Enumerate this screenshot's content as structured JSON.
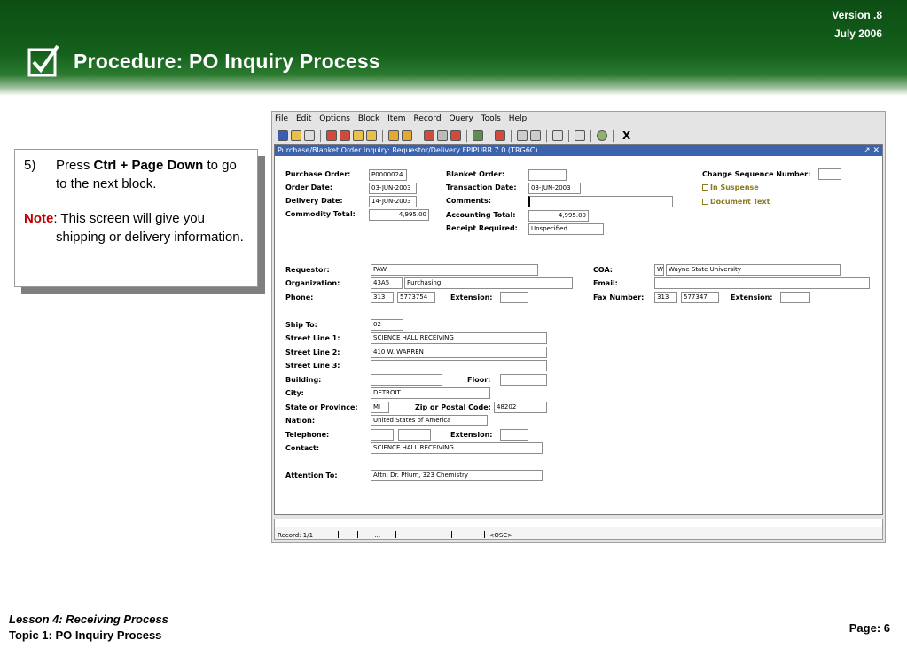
{
  "header": {
    "version": "Version .8",
    "date": "July  2006",
    "title": "Procedure: PO Inquiry Process"
  },
  "callout": {
    "step_num": "5)",
    "step_pre": "Press ",
    "step_bold": "Ctrl + Page Down",
    "step_post": " to go to the next block.",
    "note_label": "Note",
    "note_text": ":  This screen will give you shipping or delivery information."
  },
  "app": {
    "menu": [
      "File",
      "Edit",
      "Options",
      "Block",
      "Item",
      "Record",
      "Query",
      "Tools",
      "Help"
    ],
    "toolbar_exit": "X",
    "window_title": "Purchase/Blanket Order Inquiry: Requestor/Delivery  FPIPURR  7.0  (TRG6C)",
    "window_controls": "↗ ✕",
    "header_block": {
      "purchase_order_label": "Purchase Order:",
      "purchase_order": "P0000024",
      "order_date_label": "Order Date:",
      "order_date": "03-JUN-2003",
      "delivery_date_label": "Delivery Date:",
      "delivery_date": "14-JUN-2003",
      "commodity_total_label": "Commodity Total:",
      "commodity_total": "4,995.00",
      "blanket_order_label": "Blanket Order:",
      "blanket_order": "",
      "transaction_date_label": "Transaction Date:",
      "transaction_date": "03-JUN-2003",
      "comments_label": "Comments:",
      "comments": "",
      "accounting_total_label": "Accounting Total:",
      "accounting_total": "4,995.00",
      "receipt_required_label": "Receipt Required:",
      "receipt_required": "Unspecified",
      "change_seq_label": "Change Sequence Number:",
      "change_seq": "",
      "in_suspense_label": "In Suspense",
      "document_text_label": "Document Text"
    },
    "requestor_block": {
      "requestor_label": "Requestor:",
      "requestor": "PAW",
      "organization_label": "Organization:",
      "org_code": "43A5",
      "org_name": "Purchasing",
      "phone_label": "Phone:",
      "phone_area": "313",
      "phone_number": "5773754",
      "extension_label": "Extension:",
      "extension": "",
      "coa_label": "COA:",
      "coa_code": "W",
      "coa_name": "Wayne State University",
      "email_label": "Email:",
      "email": "",
      "fax_label": "Fax Number:",
      "fax_area": "313",
      "fax_number": "577347",
      "fax_extension_label": "Extension:",
      "fax_extension": ""
    },
    "ship_block": {
      "ship_to_label": "Ship To:",
      "ship_to": "02",
      "street1_label": "Street Line 1:",
      "street1": "SCIENCE HALL RECEIVING",
      "street2_label": "Street Line 2:",
      "street2": "410 W. WARREN",
      "street3_label": "Street Line 3:",
      "street3": "",
      "building_label": "Building:",
      "building": "",
      "floor_label": "Floor:",
      "floor": "",
      "city_label": "City:",
      "city": "DETROIT",
      "state_label": "State or Province:",
      "state": "MI",
      "zip_label": "Zip or Postal Code:",
      "zip": "48202",
      "nation_label": "Nation:",
      "nation": "United States of America",
      "telephone_label": "Telephone:",
      "tel_area": "",
      "tel_number": "",
      "tel_extension_label": "Extension:",
      "tel_extension": "",
      "contact_label": "Contact:",
      "contact": "SCIENCE HALL RECEIVING",
      "attention_label": "Attention To:",
      "attention": "Attn: Dr. Pflum, 323 Chemistry"
    },
    "status": {
      "record": "Record: 1/1",
      "dots": "...",
      "osc": "<OSC>"
    }
  },
  "footer": {
    "lesson": "Lesson 4: Receiving Process",
    "topic": "Topic 1: PO Inquiry Process",
    "page": "Page: 6"
  },
  "colors": {
    "header_green": "#14601b",
    "note_red": "#c00000",
    "titlebar_blue": "#3c64ae"
  }
}
